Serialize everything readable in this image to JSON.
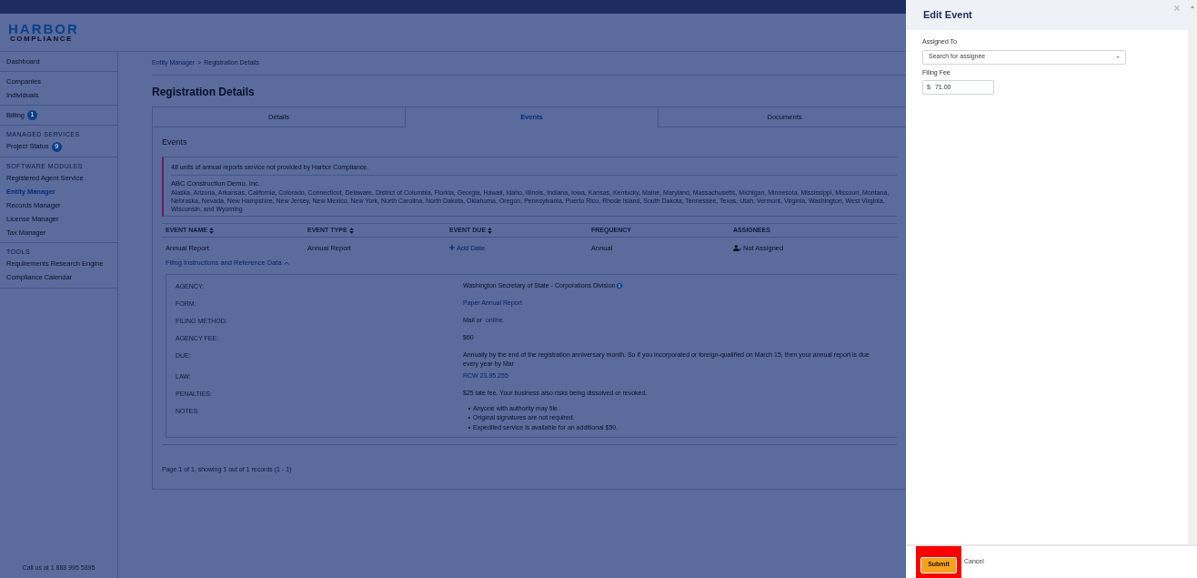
{
  "logo": {
    "line_1": "HARBOR",
    "line_2": "COMPLIANCE"
  },
  "sidebar": {
    "sections": [
      {
        "items": [
          {
            "label": "Dashboard",
            "selected": false
          }
        ]
      },
      {
        "items": [
          {
            "label": "Companies",
            "selected": false
          },
          {
            "label": "Individuals",
            "selected": false
          }
        ]
      },
      {
        "items": [
          {
            "label": "Billing",
            "selected": false,
            "badge": "1"
          }
        ]
      },
      {
        "heading": "MANAGED SERVICES",
        "items": [
          {
            "label": "Project Status",
            "selected": false,
            "badge": "9"
          }
        ]
      },
      {
        "heading": "SOFTWARE MODULES",
        "items": [
          {
            "label": "Registered Agent Service",
            "selected": false
          },
          {
            "label": "Entity Manager",
            "selected": true
          },
          {
            "label": "Records Manager",
            "selected": false
          },
          {
            "label": "License Manager",
            "selected": false
          },
          {
            "label": "Tax Manager",
            "selected": false
          }
        ]
      },
      {
        "heading": "TOOLS",
        "items": [
          {
            "label": "Requirements Research Engine",
            "selected": false
          },
          {
            "label": "Compliance Calendar",
            "selected": false
          }
        ]
      }
    ],
    "footer": "Call us at 1 888 995 5895"
  },
  "breadcrumb": [
    {
      "label": "Entity Manager",
      "kind": "link"
    },
    {
      "label": ">",
      "kind": "separator"
    },
    {
      "label": "Registration Details",
      "kind": "current"
    }
  ],
  "page_title": "Registration Details",
  "tabs": [
    {
      "label": "Details",
      "selected": false
    },
    {
      "label": "Events",
      "selected": true
    },
    {
      "label": "Documents",
      "selected": false
    }
  ],
  "section_title": "Events",
  "alert": {
    "message": "48 units of annual reports service not provided by Harbor Compliance.",
    "company": "ABC Construction Demo, Inc.",
    "states": "Alaska, Arizona, Arkansas, California, Colorado, Connecticut, Delaware, District of Columbia, Florida, Georgia, Hawaii, Idaho, Illinois, Indiana, Iowa, Kansas, Kentucky, Maine, Maryland, Massachusetts, Michigan, Minnesota, Mississippi, Missouri, Montana, Nebraska, Nevada, New Hampshire, New Jersey, New Mexico, New York, North Carolina, North Dakota, Oklahoma, Oregon, Pennsylvania, Puerto Rico, Rhode Island, South Dakota, Tennessee, Texas, Utah, Vermont, Virginia, Washington, West Virginia, Wisconsin, and Wyoming"
  },
  "table": {
    "columns": [
      {
        "label": "EVENT NAME",
        "sortable": true
      },
      {
        "label": "EVENT TYPE",
        "sortable": true
      },
      {
        "label": "EVENT DUE",
        "sortable": true
      },
      {
        "label": "FREQUENCY",
        "sortable": false
      },
      {
        "label": "ASSIGNEES",
        "sortable": false
      }
    ],
    "rows": [
      {
        "cells": [
          {
            "kind": "text",
            "text": "Annual Report"
          },
          {
            "kind": "text",
            "text": "Annual Report"
          },
          {
            "kind": "add",
            "text": "Add Date"
          },
          {
            "kind": "text",
            "text": "Annual"
          },
          {
            "kind": "assignee",
            "text": "Not Assigned"
          }
        ]
      }
    ]
  },
  "reference": {
    "toggle": "Filing Instructions and Reference Data",
    "expanded": true,
    "rows": [
      {
        "label": "AGENCY:",
        "kind": "info",
        "parts": [
          {
            "text": "Washington Secretary of State - Corporations Division",
            "link": false
          }
        ]
      },
      {
        "label": "FORM:",
        "kind": "text",
        "parts": [
          {
            "text": "Paper Annual Report",
            "link": true
          }
        ]
      },
      {
        "label": "FILING METHOD:",
        "kind": "text",
        "parts": [
          {
            "text": "Mail or ",
            "link": false
          },
          {
            "text": "online.",
            "link": true
          }
        ]
      },
      {
        "label": "AGENCY FEE:",
        "kind": "text",
        "parts": [
          {
            "text": "$60",
            "link": false
          }
        ]
      },
      {
        "label": "DUE:",
        "kind": "text",
        "parts": [
          {
            "text": "Annually by the end of the registration anniversary month. So if you incorporated or foreign-qualified on March 15, then your annual report is due every year by Mar",
            "link": false
          }
        ]
      },
      {
        "label": "LAW:",
        "kind": "text",
        "parts": [
          {
            "text": "RCW 23.95.255",
            "link": true
          }
        ]
      },
      {
        "label": "PENALTIES:",
        "kind": "text",
        "parts": [
          {
            "text": "$25 late fee. Your business also risks being dissolved or revoked.",
            "link": false
          }
        ]
      },
      {
        "label": "NOTES:",
        "kind": "list",
        "items": [
          "Anyone with authority may file.",
          "Original signatures are not required.",
          "Expedited service is available for an additional $50."
        ]
      }
    ]
  },
  "pagination": "Page 1 of 1, showing 1 out of 1 records (1 - 1)",
  "panel": {
    "title": "Edit Event",
    "fields": [
      {
        "kind": "select",
        "label": "Assigned To",
        "placeholder": "Search for assignee"
      },
      {
        "kind": "money",
        "label": "Filing Fee",
        "prefix": "$",
        "value": "71.00"
      }
    ],
    "submit": "Submit",
    "cancel": "Cancel",
    "submit_highlighted": true
  }
}
